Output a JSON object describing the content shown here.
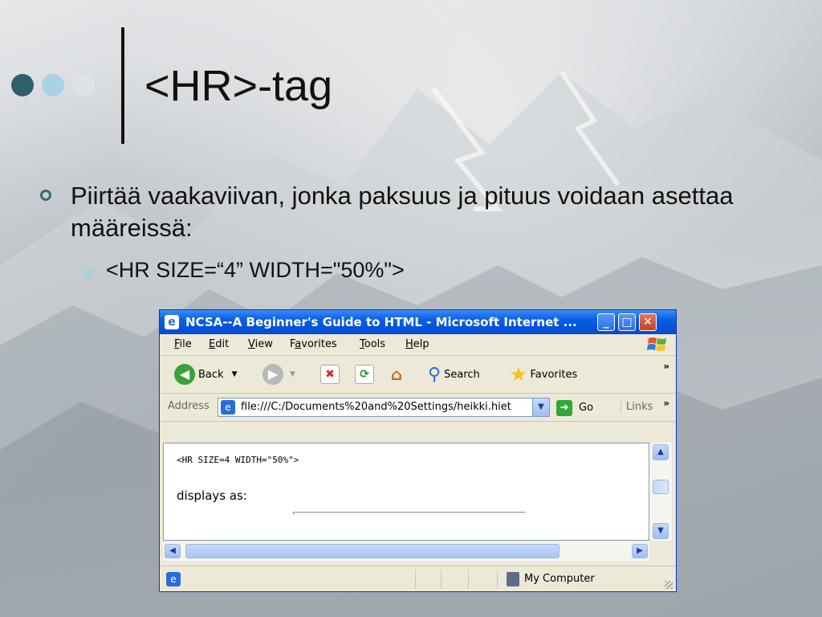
{
  "slide": {
    "title": "<HR>-tag",
    "bullet1": "Piirtää vaakaviivan, jonka paksuus ja pituus voidaan asettaa määreissä:",
    "bullet2": "<HR SIZE=“4” WIDTH=\"50%\">",
    "accent_colors": [
      "#2f5f6a",
      "#a9d3e4",
      "#dfe3e6"
    ]
  },
  "browser": {
    "title": "NCSA--A Beginner's Guide to HTML - Microsoft Internet ...",
    "menu": [
      "File",
      "Edit",
      "View",
      "Favorites",
      "Tools",
      "Help"
    ],
    "menu_underline": [
      "F",
      "E",
      "V",
      "a",
      "T",
      "H"
    ],
    "toolbar": {
      "back_label": "Back",
      "search_label": "Search",
      "favorites_label": "Favorites"
    },
    "address": {
      "label": "Address",
      "value": "file:///C:/Documents%20and%20Settings/heikki.hiet",
      "go_label": "Go",
      "links_label": "Links"
    },
    "content": {
      "code_line": "<HR SIZE=4 WIDTH=\"50%\">",
      "displays_text": "displays as:",
      "hr_width_percent": 50
    },
    "status": {
      "zone_label": "My Computer"
    }
  }
}
